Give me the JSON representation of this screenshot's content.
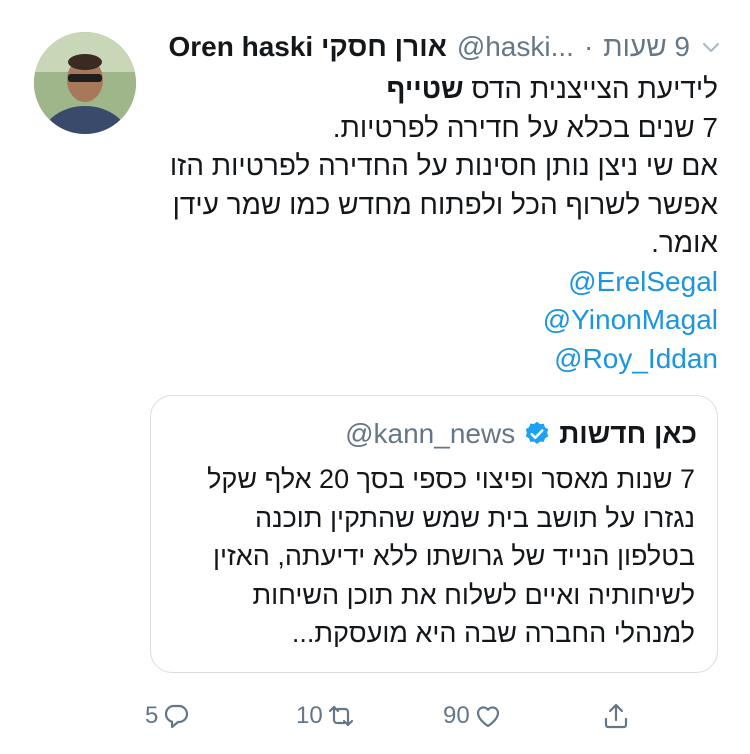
{
  "tweet": {
    "author_name": "Oren haski אורן חסקי",
    "handle": "@haski...",
    "separator": "·",
    "time": "9 שעות",
    "body_lines": [
      "לידיעת הצייצנית הדס",
      "7 שנים בכלא על חדירה לפרטיות.",
      "אם שי ניצן נותן חסינות  על החדירה לפרטיות הזו",
      "אפשר לשרוף הכל ולפתוח מחדש כמו שמר עידן",
      "אומר."
    ],
    "bold_word": "שטייף",
    "mentions": [
      "@ErelSegal",
      "@YinonMagal",
      "@Roy_Iddan"
    ],
    "quoted": {
      "name": "כאן חדשות",
      "handle": "@kann_news",
      "verified": true,
      "body_lines": [
        "7 שנות מאסר ופיצוי כספי בסך 20 אלף שקל",
        "נגזרו על תושב בית שמש שהתקין תוכנה",
        "בטלפון הנייד של גרושתו ללא ידיעתה, האזין",
        "לשיחותיה ואיים לשלוח את תוכן השיחות",
        "למנהלי החברה שבה היא מועסקת..."
      ]
    },
    "actions": {
      "replies": "5",
      "retweets": "10",
      "likes": "90"
    }
  },
  "icons": {
    "chevron": "chevron-down-icon",
    "verified": "verified-badge-icon",
    "reply": "reply-icon",
    "retweet": "retweet-icon",
    "like": "heart-icon",
    "share": "share-icon"
  },
  "colors": {
    "link": "#1b95e0",
    "secondary_text": "#657786",
    "border": "#d9dee3",
    "verified": "#1da1f2"
  }
}
